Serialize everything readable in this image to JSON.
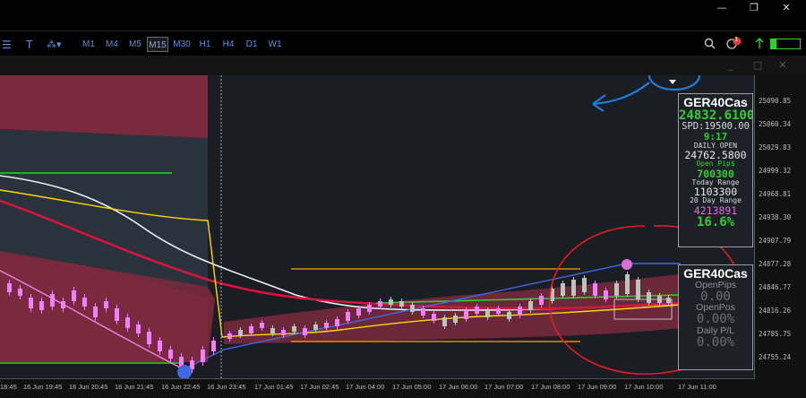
{
  "window_controls": {
    "minimize": "—",
    "restore": "❐",
    "close": "✕"
  },
  "toolbar": {
    "timeframes": [
      "M1",
      "M4",
      "M5",
      "M15",
      "M30",
      "H1",
      "H4",
      "D1",
      "W1"
    ],
    "active_timeframe": "M15"
  },
  "notification_count": "1",
  "chart_window_controls": {
    "minimize": "_",
    "maximize": "□",
    "close": "✕"
  },
  "price_axis": [
    "25090.85",
    "25060.34",
    "25029.83",
    "24999.32",
    "24968.81",
    "24938.30",
    "24907.79",
    "24877.28",
    "24846.77",
    "24816.26",
    "24785.75",
    "24755.24"
  ],
  "time_axis": [
    "18:45",
    "16 Jun 19:45",
    "16 Jun 20:45",
    "16 Jun 21:45",
    "16 Jun 22:45",
    "16 Jun 23:45",
    "17 Jun 01:45",
    "17 Jun 02:45",
    "17 Jun 04:00",
    "17 Jun 05:00",
    "17 Jun 06:00",
    "17 Jun 07:00",
    "17 Jun 08:00",
    "17 Jun 09:00",
    "17 Jun 10:00",
    "17 Jun 11:00"
  ],
  "info_panel": {
    "symbol": "GER40Cas",
    "price": "24832.6100",
    "spread": "SPD:19500.00",
    "timer": "9:17",
    "daily_open_label": "DAILY OPEN",
    "daily_open": "24762.5800",
    "open_pips_label": "Open Pip$",
    "open_pips": "700300",
    "today_range_label": "Today Range",
    "today_range": "1103300",
    "day20_range_label": "20 Day Range",
    "day20_range": "4213891",
    "percent": "16.6%"
  },
  "pl_panel": {
    "symbol": "GER40Cas",
    "open_pips_label": "OpenPips",
    "open_pips": "0.00",
    "open_pos_label": "OpenPos",
    "open_pos": "0.00%",
    "daily_pl_label": "Daily P/L",
    "daily_pl": "0.00%"
  },
  "colors": {
    "bull_candle": "#ee82ee",
    "bear_candle": "#c0c0c0",
    "band_fill": "#7a2a3c",
    "red_ma": "#dc143c",
    "white_ma": "#f0f0f0",
    "gold_ma": "#ffd700",
    "orange_line": "#ffa500",
    "trend_line": "#4169e1",
    "green_line": "#32cd32",
    "annotation_blue": "#1e7fd8",
    "annotation_red": "#e01e1e",
    "price_up": "#32cd32",
    "accent_violet": "#da70d6"
  }
}
